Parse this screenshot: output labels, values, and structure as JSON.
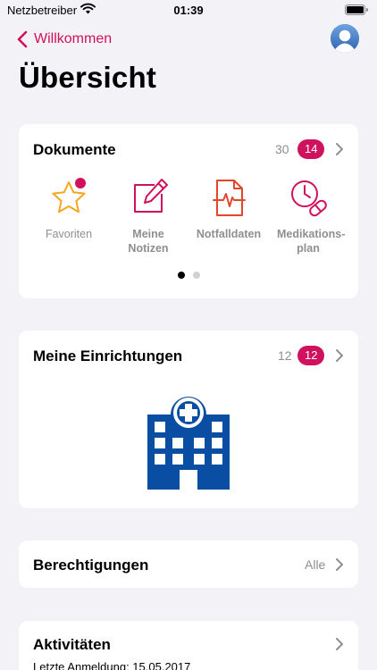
{
  "status_bar": {
    "carrier": "Netzbetreiber",
    "time": "01:39"
  },
  "nav": {
    "back_label": "Willkommen"
  },
  "page": {
    "title": "Übersicht"
  },
  "documents": {
    "title": "Dokumente",
    "count": "30",
    "badge": "14",
    "items": [
      {
        "label": "Favoriten",
        "icon": "star-icon",
        "has_badge_dot": true
      },
      {
        "label": "Meine Notizen",
        "icon": "note-edit-icon"
      },
      {
        "label": "Notfalldaten",
        "icon": "emergency-document-icon"
      },
      {
        "label": "Medikations-plan",
        "icon": "medication-plan-icon"
      }
    ],
    "pager": {
      "pages": 2,
      "current": 1
    }
  },
  "facilities": {
    "title": "Meine Einrichtungen",
    "count": "12",
    "badge": "12",
    "icon": "hospital-icon"
  },
  "permissions": {
    "title": "Berechtigungen",
    "value": "Alle"
  },
  "activities": {
    "title": "Aktivitäten",
    "last_login": "Letzte Anmeldung: 15.05.2017"
  },
  "colors": {
    "accent": "#d0115e",
    "hospital_blue": "#0a4ea3",
    "background": "#f2f2f7",
    "secondary_text": "#8e8e93"
  }
}
